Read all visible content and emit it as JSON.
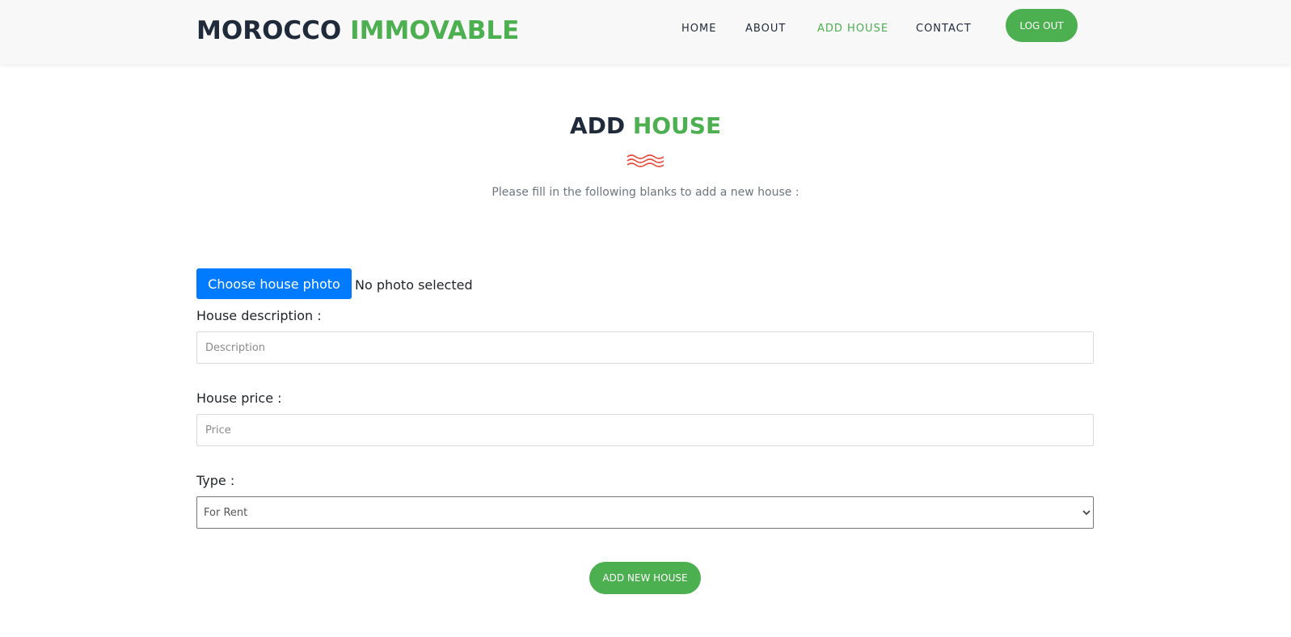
{
  "brand": {
    "part1": "MOROCCO",
    "part2": "IMMOVABLE"
  },
  "nav": {
    "items": [
      {
        "label": "HOME",
        "active": false
      },
      {
        "label": "ABOUT",
        "active": false
      },
      {
        "label": "ADD HOUSE",
        "active": true
      },
      {
        "label": "CONTACT",
        "active": false
      }
    ],
    "logout_label": "LOG OUT"
  },
  "heading": {
    "part1": "ADD",
    "part2": "HOUSE",
    "subtitle": "Please fill in the following blanks to add a new house :"
  },
  "form": {
    "photo_button_label": "Choose house photo",
    "photo_status": "No photo selected",
    "description_label": "House description :",
    "description_placeholder": "Description",
    "description_value": "",
    "price_label": "House price :",
    "price_placeholder": "Price",
    "price_value": "",
    "type_label": "Type :",
    "type_selected": "For Rent",
    "submit_label": "ADD NEW HOUSE"
  },
  "colors": {
    "accent_green": "#4caf50",
    "primary_blue": "#007bff",
    "dark_text": "#1f2a3a",
    "wave_red": "#e74c3c",
    "topbar_bg": "#f8f8f8"
  },
  "icons": {
    "divider": "wave-divider-icon",
    "select_arrow": "chevron-down-icon"
  }
}
